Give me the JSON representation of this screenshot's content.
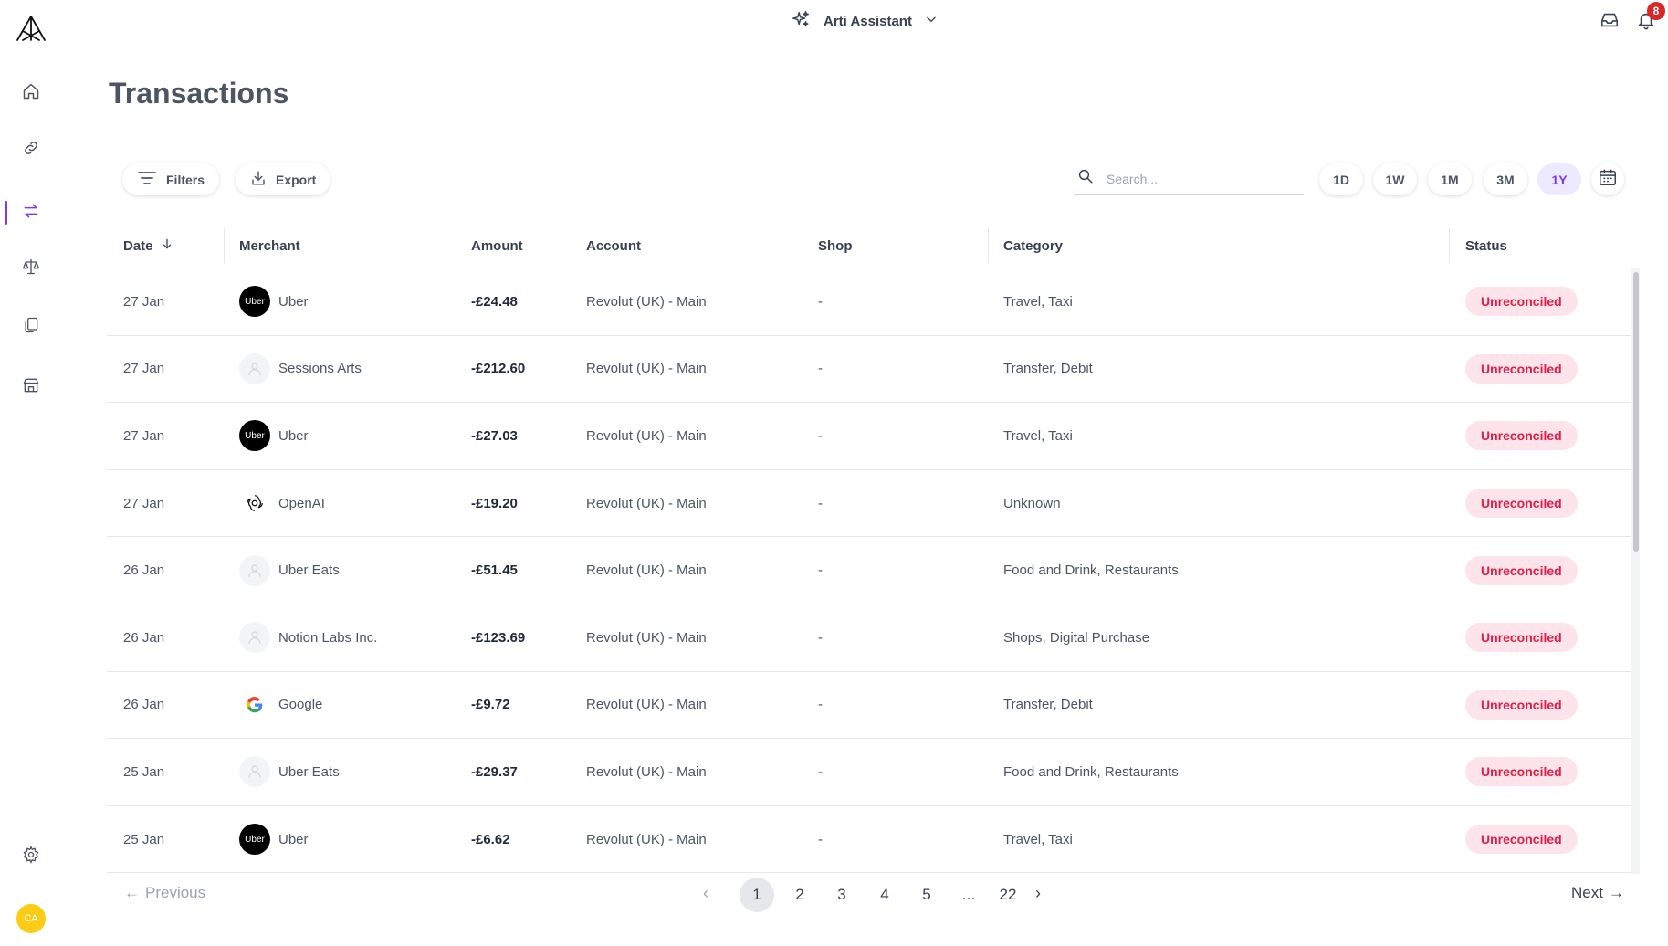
{
  "app": {
    "assistant_label": "Arti Assistant",
    "notification_count": "8",
    "user_initials": "CA"
  },
  "sidebar": {
    "items": [
      {
        "icon": "home-icon"
      },
      {
        "icon": "link-icon"
      },
      {
        "icon": "transactions-icon",
        "active": true
      },
      {
        "icon": "scale-icon"
      },
      {
        "icon": "documents-icon"
      },
      {
        "icon": "store-icon"
      }
    ],
    "settings_icon": "gear-icon"
  },
  "page": {
    "title": "Transactions"
  },
  "toolbar": {
    "filters_label": "Filters",
    "export_label": "Export",
    "search_placeholder": "Search...",
    "ranges": [
      "1D",
      "1W",
      "1M",
      "3M",
      "1Y"
    ],
    "active_range": "1Y"
  },
  "table": {
    "columns": [
      "Date",
      "Merchant",
      "Amount",
      "Account",
      "Shop",
      "Category",
      "Status"
    ],
    "rows": [
      {
        "date": "27 Jan",
        "merchant": "Uber",
        "logo": "uber",
        "amount": "-£24.48",
        "account": "Revolut (UK) - Main",
        "shop": "-",
        "category": "Travel, Taxi",
        "status": "Unreconciled"
      },
      {
        "date": "27 Jan",
        "merchant": "Sessions Arts",
        "logo": "default",
        "amount": "-£212.60",
        "account": "Revolut (UK) - Main",
        "shop": "-",
        "category": "Transfer, Debit",
        "status": "Unreconciled"
      },
      {
        "date": "27 Jan",
        "merchant": "Uber",
        "logo": "uber",
        "amount": "-£27.03",
        "account": "Revolut (UK) - Main",
        "shop": "-",
        "category": "Travel, Taxi",
        "status": "Unreconciled"
      },
      {
        "date": "27 Jan",
        "merchant": "OpenAI",
        "logo": "openai",
        "amount": "-£19.20",
        "account": "Revolut (UK) - Main",
        "shop": "-",
        "category": "Unknown",
        "status": "Unreconciled"
      },
      {
        "date": "26 Jan",
        "merchant": "Uber Eats",
        "logo": "default",
        "amount": "-£51.45",
        "account": "Revolut (UK) - Main",
        "shop": "-",
        "category": "Food and Drink, Restaurants",
        "status": "Unreconciled"
      },
      {
        "date": "26 Jan",
        "merchant": "Notion Labs Inc.",
        "logo": "default",
        "amount": "-£123.69",
        "account": "Revolut (UK) - Main",
        "shop": "-",
        "category": "Shops, Digital Purchase",
        "status": "Unreconciled"
      },
      {
        "date": "26 Jan",
        "merchant": "Google",
        "logo": "google",
        "amount": "-£9.72",
        "account": "Revolut (UK) - Main",
        "shop": "-",
        "category": "Transfer, Debit",
        "status": "Unreconciled"
      },
      {
        "date": "25 Jan",
        "merchant": "Uber Eats",
        "logo": "default",
        "amount": "-£29.37",
        "account": "Revolut (UK) - Main",
        "shop": "-",
        "category": "Food and Drink, Restaurants",
        "status": "Unreconciled"
      },
      {
        "date": "25 Jan",
        "merchant": "Uber",
        "logo": "uber",
        "amount": "-£6.62",
        "account": "Revolut (UK) - Main",
        "shop": "-",
        "category": "Travel, Taxi",
        "status": "Unreconciled"
      }
    ]
  },
  "pagination": {
    "previous_label": "Previous",
    "next_label": "Next",
    "pages": [
      "1",
      "2",
      "3",
      "4",
      "5",
      "...",
      "22"
    ],
    "current": "1"
  },
  "colors": {
    "accent": "#7c3aed",
    "status_bg": "#fde4ea",
    "status_text": "#e11d48"
  }
}
